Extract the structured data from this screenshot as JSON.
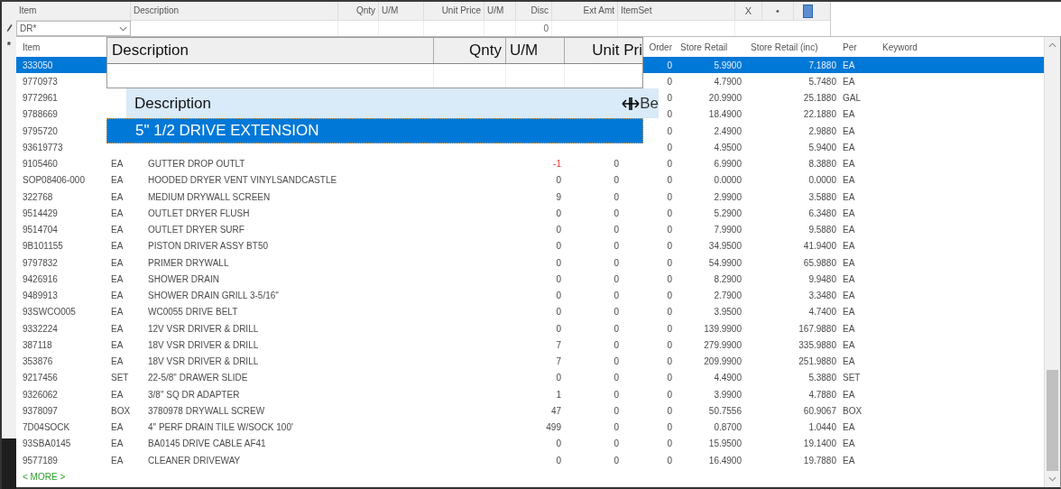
{
  "grid": {
    "columns": [
      {
        "label": "Item"
      },
      {
        "label": "Description"
      },
      {
        "label": "Qnty"
      },
      {
        "label": "U/M"
      },
      {
        "label": "Unit Price"
      },
      {
        "label": "U/M"
      },
      {
        "label": "Disc"
      },
      {
        "label": "Ext Amt"
      },
      {
        "label": "ItemSet"
      }
    ],
    "header_buttons": [
      "X",
      "•"
    ],
    "item_filter": {
      "value": "DR*"
    },
    "disc_value": "0",
    "new_row_marker": "*"
  },
  "lookup": {
    "columns": [
      "Item",
      "Order",
      "Store Retail",
      "Store Retail (inc)",
      "Per",
      "Keyword"
    ],
    "rows": [
      {
        "item": "333050",
        "order": "0",
        "retail": "5.9900",
        "retail_inc": "7.1880",
        "per": "EA",
        "selected": true
      },
      {
        "item": "9770973",
        "order": "0",
        "retail": "4.7900",
        "retail_inc": "5.7480",
        "per": "EA",
        "selected": false
      },
      {
        "item": "9772961",
        "order": "0",
        "retail": "20.9900",
        "retail_inc": "25.1880",
        "per": "GAL",
        "selected": false
      },
      {
        "item": "9788669",
        "order": "0",
        "retail": "18.4900",
        "retail_inc": "22.1880",
        "per": "EA",
        "selected": false
      },
      {
        "item": "9795720",
        "order": "0",
        "retail": "2.4900",
        "retail_inc": "2.9880",
        "per": "EA",
        "selected": false
      },
      {
        "item": "93619773",
        "order": "0",
        "retail": "4.9500",
        "retail_inc": "5.9400",
        "per": "EA",
        "selected": false
      },
      {
        "item": "9105460",
        "um": "EA",
        "description": "GUTTER DROP OUTLT",
        "qty": "-1",
        "column_5": "0",
        "order": "0",
        "retail": "6.9900",
        "retail_inc": "8.3880",
        "per": "EA",
        "selected": false,
        "negative": true
      },
      {
        "item": "SOP08406-000",
        "um": "EA",
        "description": "HOODED DRYER VENT VINYLSANDCASTLE",
        "qty": "0",
        "column_5": "0",
        "order": "0",
        "retail": "0.0000",
        "retail_inc": "0.0000",
        "per": "EA",
        "selected": false,
        "negative": false
      },
      {
        "item": "322768",
        "um": "EA",
        "description": "MEDIUM DRYWALL SCREEN",
        "qty": "9",
        "column_5": "0",
        "order": "0",
        "retail": "2.9900",
        "retail_inc": "3.5880",
        "per": "EA",
        "selected": false,
        "negative": false
      },
      {
        "item": "9514429",
        "um": "EA",
        "description": "OUTLET DRYER FLUSH",
        "qty": "0",
        "column_5": "0",
        "order": "0",
        "retail": "5.2900",
        "retail_inc": "6.3480",
        "per": "EA",
        "selected": false,
        "negative": false
      },
      {
        "item": "9514704",
        "um": "EA",
        "description": "OUTLET DRYER SURF",
        "qty": "0",
        "column_5": "0",
        "order": "0",
        "retail": "7.9900",
        "retail_inc": "9.5880",
        "per": "EA",
        "selected": false,
        "negative": false
      },
      {
        "item": "9B101155",
        "um": "EA",
        "description": "PISTON DRIVER ASSY   BT50",
        "qty": "0",
        "column_5": "0",
        "order": "0",
        "retail": "34.9500",
        "retail_inc": "41.9400",
        "per": "EA",
        "selected": false,
        "negative": false
      },
      {
        "item": "9797832",
        "um": "EA",
        "description": "PRIMER DRYWALL",
        "qty": "0",
        "column_5": "0",
        "order": "0",
        "retail": "54.9900",
        "retail_inc": "65.9880",
        "per": "EA",
        "selected": false,
        "negative": false
      },
      {
        "item": "9426916",
        "um": "EA",
        "description": "SHOWER DRAIN",
        "qty": "0",
        "column_5": "0",
        "order": "0",
        "retail": "8.2900",
        "retail_inc": "9.9480",
        "per": "EA",
        "selected": false,
        "negative": false
      },
      {
        "item": "9489913",
        "um": "EA",
        "description": "SHOWER DRAIN GRILL 3-5/16\"",
        "qty": "0",
        "column_5": "0",
        "order": "0",
        "retail": "2.7900",
        "retail_inc": "3.3480",
        "per": "EA",
        "selected": false,
        "negative": false
      },
      {
        "item": "93SWCO005",
        "um": "EA",
        "description": "WC0055 DRIVE BELT",
        "qty": "0",
        "column_5": "0",
        "order": "0",
        "retail": "3.9500",
        "retail_inc": "4.7400",
        "per": "EA",
        "selected": false,
        "negative": false
      },
      {
        "item": "9332224",
        "um": "EA",
        "description": "12V VSR DRIVER & DRILL",
        "qty": "0",
        "column_5": "0",
        "order": "0",
        "retail": "139.9900",
        "retail_inc": "167.9880",
        "per": "EA",
        "selected": false,
        "negative": false
      },
      {
        "item": "387118",
        "um": "EA",
        "description": "18V VSR DRIVER & DRILL",
        "qty": "7",
        "column_5": "0",
        "order": "0",
        "retail": "279.9900",
        "retail_inc": "335.9880",
        "per": "EA",
        "selected": false,
        "negative": false
      },
      {
        "item": "353876",
        "um": "EA",
        "description": "18V VSR DRIVER & DRILL",
        "qty": "7",
        "column_5": "0",
        "order": "0",
        "retail": "209.9900",
        "retail_inc": "251.9880",
        "per": "EA",
        "selected": false,
        "negative": false
      },
      {
        "item": "9217456",
        "um": "SET",
        "description": "22-5/8\" DRAWER SLIDE",
        "qty": "0",
        "column_5": "0",
        "order": "0",
        "retail": "4.4900",
        "retail_inc": "5.3880",
        "per": "SET",
        "selected": false,
        "negative": false
      },
      {
        "item": "9326062",
        "um": "EA",
        "description": "3/8\" SQ DR ADAPTER",
        "qty": "1",
        "column_5": "0",
        "order": "0",
        "retail": "3.9900",
        "retail_inc": "4.7880",
        "per": "EA",
        "selected": false,
        "negative": false
      },
      {
        "item": "9378097",
        "um": "BOX",
        "description": "3780978 DRYWALL SCREW",
        "qty": "47",
        "column_5": "0",
        "order": "0",
        "retail": "50.7556",
        "retail_inc": "60.9067",
        "per": "BOX",
        "selected": false,
        "negative": false
      },
      {
        "item": "7D04SOCK",
        "um": "EA",
        "description": "4\" PERF DRAIN TILE W/SOCK 100'",
        "qty": "499",
        "column_5": "0",
        "order": "0",
        "retail": "0.8700",
        "retail_inc": "1.0440",
        "per": "EA",
        "selected": false,
        "negative": false
      },
      {
        "item": "93SBA0145",
        "um": "EA",
        "description": "BA0145  DRIVE CABLE AF41",
        "qty": "0",
        "column_5": "0",
        "order": "0",
        "retail": "15.9500",
        "retail_inc": "19.1400",
        "per": "EA",
        "selected": false,
        "negative": false
      },
      {
        "item": "9577189",
        "um": "EA",
        "description": "CLEANER DRIVEWAY",
        "qty": "0",
        "column_5": "0",
        "order": "0",
        "retail": "16.4900",
        "retail_inc": "19.7880",
        "per": "EA",
        "selected": false,
        "negative": false
      }
    ],
    "more_link": "< MORE >"
  },
  "dragged_header": {
    "columns": [
      "Description",
      "Qnty",
      "U/M",
      "Unit Pri"
    ]
  },
  "dragged_column": {
    "title": "Description",
    "cut_label": "Be",
    "value": "5\" 1/2 DRIVE EXTENSION"
  }
}
